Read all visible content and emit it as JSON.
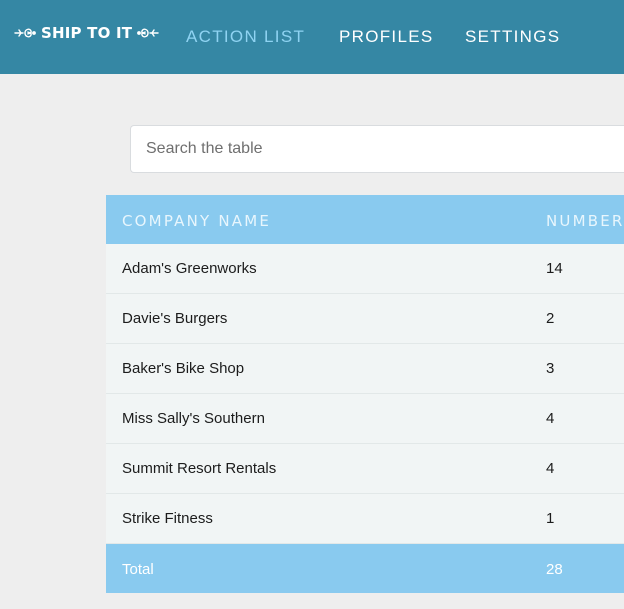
{
  "app": {
    "logo_text": "SHIP TO IT"
  },
  "nav": {
    "items": [
      {
        "label": "ACTION LIST",
        "active": true
      },
      {
        "label": "PROFILES",
        "active": false
      },
      {
        "label": "SETTINGS",
        "active": false
      }
    ]
  },
  "search": {
    "placeholder": "Search the table",
    "value": ""
  },
  "table": {
    "columns": [
      "COMPANY NAME",
      "NUMBER"
    ],
    "rows": [
      {
        "company": "Adam's Greenworks",
        "number": "14"
      },
      {
        "company": "Davie's Burgers",
        "number": "2"
      },
      {
        "company": "Baker's Bike Shop",
        "number": "3"
      },
      {
        "company": "Miss Sally's Southern",
        "number": "4"
      },
      {
        "company": "Summit Resort Rentals",
        "number": "4"
      },
      {
        "company": "Strike Fitness",
        "number": "1"
      }
    ],
    "total": {
      "label": "Total",
      "number": "28"
    }
  },
  "colors": {
    "header_bg": "#3587a4",
    "active_nav": "#8fd3f2",
    "table_header_bg": "#89caef",
    "row_bg": "#f1f5f5",
    "page_bg": "#eeeeee"
  }
}
